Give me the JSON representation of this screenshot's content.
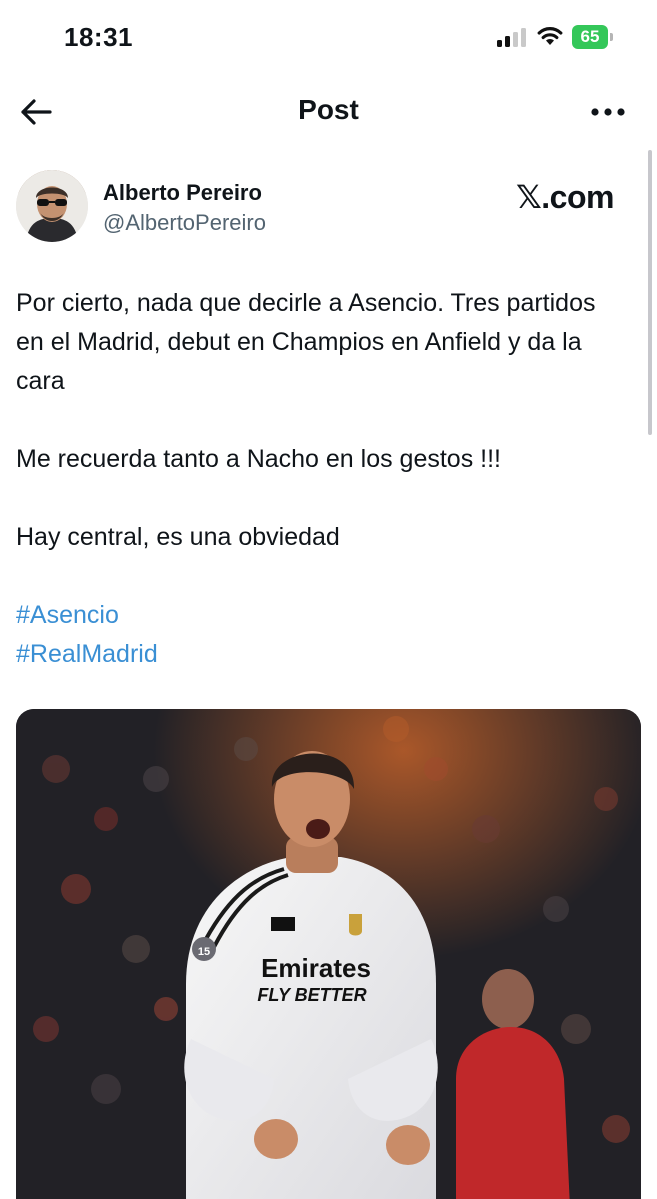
{
  "status_bar": {
    "time": "18:31",
    "battery_level": "65",
    "battery_color": "#34c759",
    "icons": [
      "signal-icon",
      "wifi-icon",
      "battery-icon"
    ]
  },
  "nav": {
    "title": "Post",
    "back_icon": "arrow-left-icon",
    "more_icon": "more-horizontal-icon"
  },
  "author": {
    "display_name": "Alberto Pereiro",
    "handle": "@AlbertoPereiro",
    "source_logo_x": "𝕏",
    "source_logo_text": ".com"
  },
  "post": {
    "paragraphs": [
      "Por cierto, nada que decirle a Asencio. Tres partidos en el Madrid, debut en Champios en Anfield y da la cara",
      "Me recuerda tanto a Nacho en los gestos !!!",
      "Hay central, es una obviedad"
    ],
    "hashtags": [
      "#Asencio",
      "#RealMadrid"
    ],
    "hashtag_color": "#3a8fd4"
  },
  "media": {
    "shirt_sponsor_line1": "Emirates",
    "shirt_sponsor_line2": "FLY BETTER",
    "shirt_number": "15"
  }
}
